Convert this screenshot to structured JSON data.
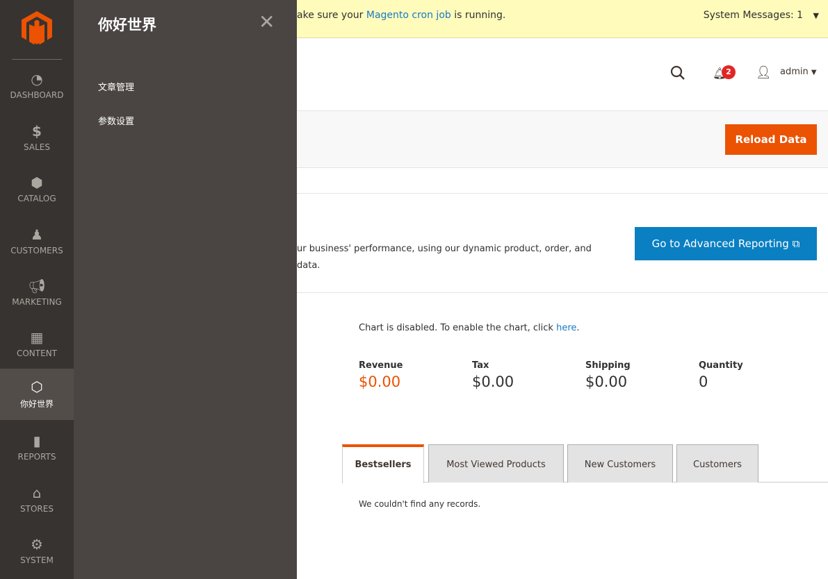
{
  "colors": {
    "accent": "#eb5202",
    "link": "#1979c3",
    "nav_bg": "#373330",
    "flyout_bg": "#4a4542"
  },
  "nav": {
    "items": [
      {
        "label": "DASHBOARD",
        "icon": "dashboard-icon"
      },
      {
        "label": "SALES",
        "icon": "dollar-icon"
      },
      {
        "label": "CATALOG",
        "icon": "box-icon"
      },
      {
        "label": "CUSTOMERS",
        "icon": "person-icon"
      },
      {
        "label": "MARKETING",
        "icon": "megaphone-icon"
      },
      {
        "label": "CONTENT",
        "icon": "layout-icon"
      },
      {
        "label": "你好世界",
        "icon": "hexagon-icon",
        "active": true
      },
      {
        "label": "REPORTS",
        "icon": "bar-chart-icon"
      },
      {
        "label": "STORES",
        "icon": "store-icon"
      },
      {
        "label": "SYSTEM",
        "icon": "gear-icon"
      }
    ]
  },
  "flyout": {
    "title": "你好世界",
    "items": [
      "文章管理",
      "参数设置"
    ]
  },
  "messages": {
    "prefix": "ake sure your ",
    "link": "Magento cron job",
    "suffix": " is running.",
    "system": "System Messages: 1"
  },
  "header": {
    "notifications": "2",
    "user": "admin"
  },
  "actions": {
    "reload": "Reload Data"
  },
  "advanced": {
    "text": "ur business' performance, using our dynamic product, order, and data.",
    "line1": "ur business' performance, using our dynamic product, order, and",
    "line2": "data.",
    "button": "Go to Advanced Reporting"
  },
  "chart": {
    "prefix": "Chart is disabled. To enable the chart, click ",
    "link": "here",
    "suffix": "."
  },
  "totals": [
    {
      "label": "Revenue",
      "value": "$0.00"
    },
    {
      "label": "Tax",
      "value": "$0.00"
    },
    {
      "label": "Shipping",
      "value": "$0.00"
    },
    {
      "label": "Quantity",
      "value": "0"
    }
  ],
  "tabs": [
    "Bestsellers",
    "Most Viewed Products",
    "New Customers",
    "Customers"
  ],
  "no_records": "We couldn't find any records."
}
